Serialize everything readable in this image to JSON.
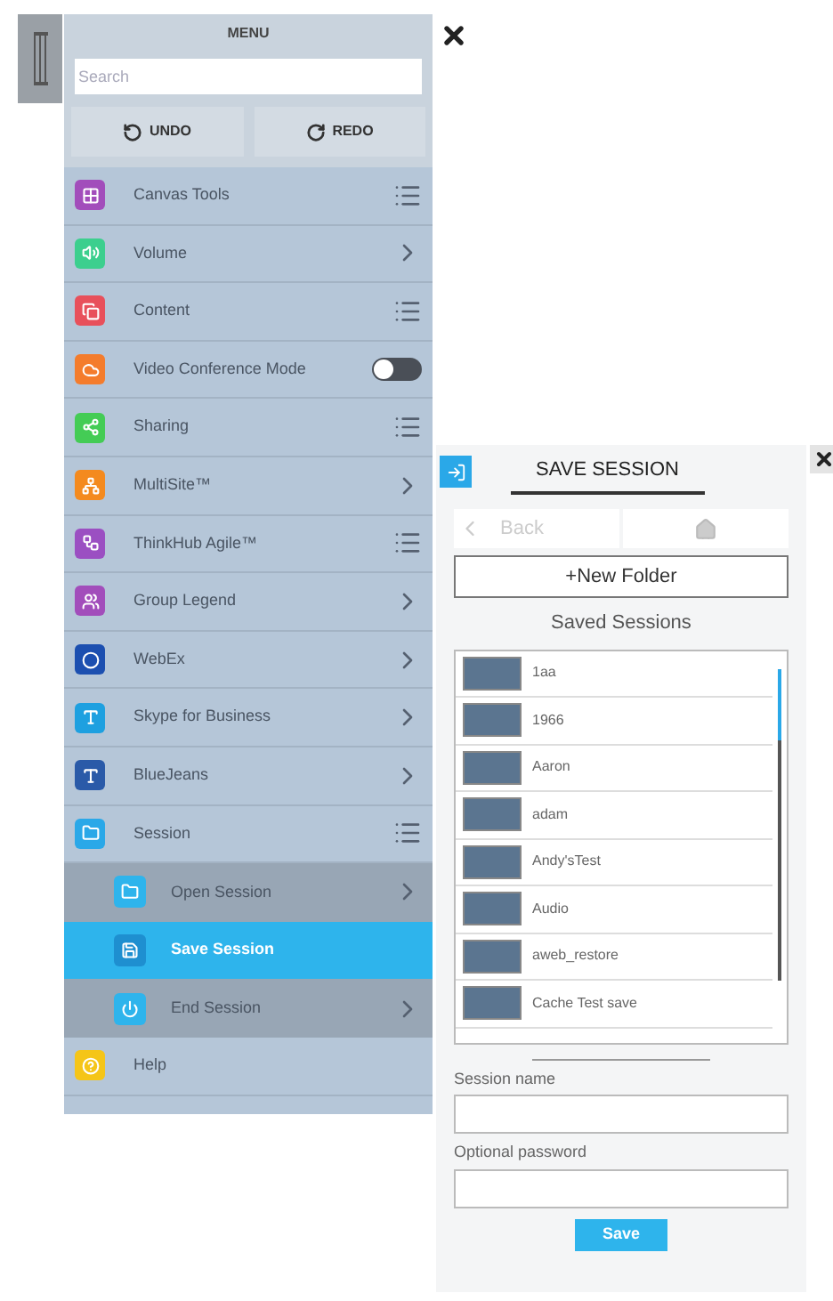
{
  "menu": {
    "title": "MENU",
    "search": {
      "placeholder": "Search"
    },
    "actions": [
      {
        "label": "UNDO",
        "kind": "undo"
      },
      {
        "label": "REDO",
        "kind": "redo"
      }
    ],
    "items": [
      {
        "label": "Canvas Tools",
        "color": "#a24dbb",
        "kind": "list"
      },
      {
        "label": "Volume",
        "color": "#3ccf8e",
        "kind": "chevron"
      },
      {
        "label": "Content",
        "color": "#e8505b",
        "kind": "list"
      },
      {
        "label": "Video Conference Mode",
        "color": "#f47c2c",
        "kind": "toggle",
        "on": false
      },
      {
        "label": "Sharing",
        "color": "#44cc55",
        "kind": "list"
      },
      {
        "label": "MultiSite™",
        "color": "#f48a1e",
        "kind": "chevron"
      },
      {
        "label": "ThinkHub Agile™",
        "color": "#9b4fc2",
        "kind": "list"
      },
      {
        "label": "Group Legend",
        "color": "#a24dbb",
        "kind": "chevron"
      },
      {
        "label": "WebEx",
        "color": "#1c4fb0",
        "kind": "chevron"
      },
      {
        "label": "Skype for Business",
        "color": "#1ea0e0",
        "kind": "chevron"
      },
      {
        "label": "BlueJeans",
        "color": "#2a5aa8",
        "kind": "chevron"
      },
      {
        "label": "Session",
        "color": "#2aa8e8",
        "kind": "list",
        "children": [
          {
            "label": "Open Session",
            "kind": "chevron",
            "selected": false
          },
          {
            "label": "Save Session",
            "kind": "plain",
            "selected": true
          },
          {
            "label": "End Session",
            "kind": "chevron",
            "selected": false
          }
        ]
      },
      {
        "label": "Help",
        "color": "#f5c518",
        "kind": "plain"
      }
    ]
  },
  "save_panel": {
    "title": "SAVE SESSION",
    "back": {
      "label": "Back",
      "disabled": true
    },
    "new_folder": "+New Folder",
    "list_title": "Saved Sessions",
    "sessions": [
      {
        "name": "1aa"
      },
      {
        "name": "1966"
      },
      {
        "name": "Aaron"
      },
      {
        "name": "adam"
      },
      {
        "name": "Andy'sTest"
      },
      {
        "name": "Audio"
      },
      {
        "name": "aweb_restore"
      },
      {
        "name": "Cache Test save"
      }
    ],
    "fields": [
      {
        "label": "Session name"
      },
      {
        "label": "Optional password"
      }
    ],
    "save_button": "Save"
  }
}
